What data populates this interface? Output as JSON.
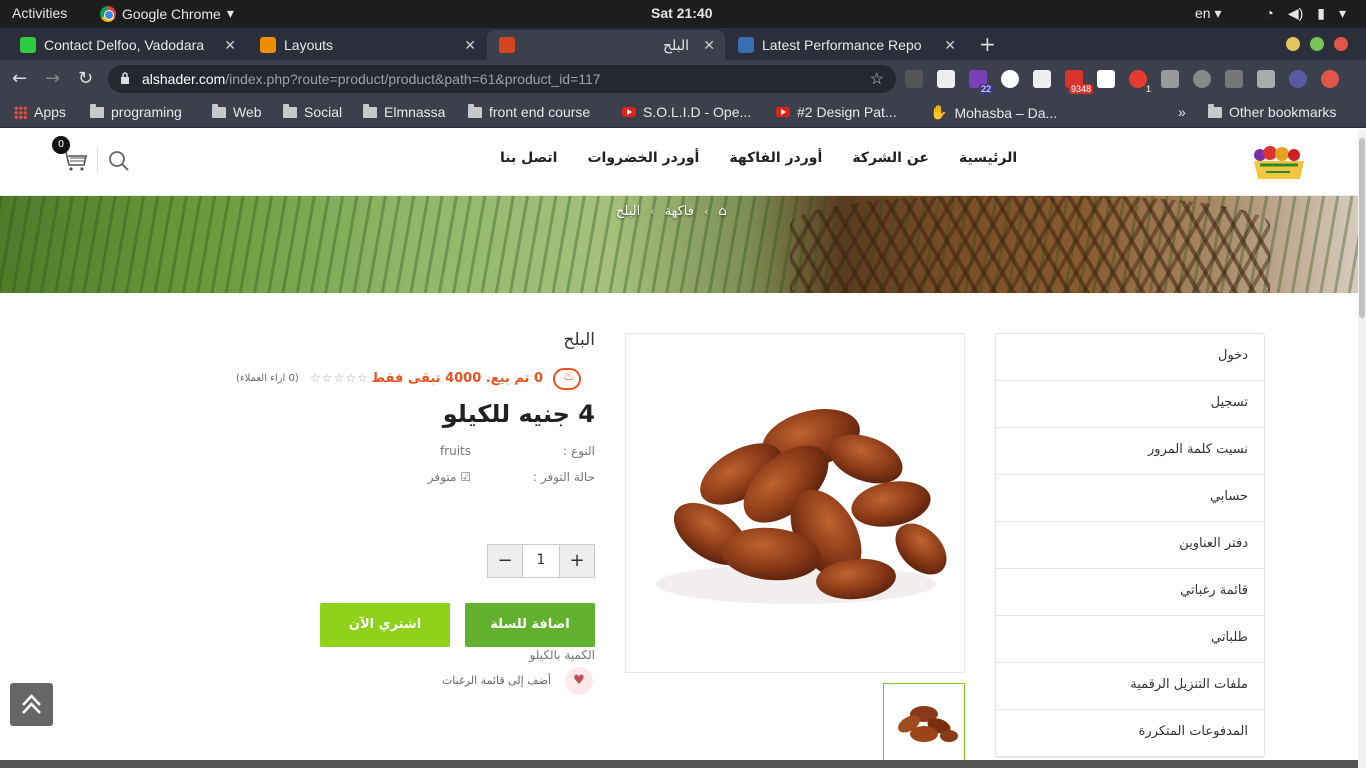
{
  "os": {
    "activities": "Activities",
    "app_name": "Google Chrome",
    "clock": "Sat 21:40",
    "lang": "en"
  },
  "tabs": [
    {
      "label": "Contact Delfoo, Vadodara"
    },
    {
      "label": "Layouts"
    },
    {
      "label": "البلح"
    },
    {
      "label": "Latest Performance Repo"
    }
  ],
  "address": {
    "host": "alshader.com",
    "path": "/index.php?route=product/product&path=61&product_id=117"
  },
  "extensions": {
    "badge_1": "22",
    "badge_2": "9348",
    "badge_3": "1"
  },
  "bookmarks": {
    "apps": "Apps",
    "items": [
      "programing",
      "Web",
      "Social",
      "Elmnassa",
      "front end course"
    ],
    "videos": [
      "S.O.L.I.D - Ope...",
      "#2 Design Pat..."
    ],
    "mohasba": "Mohasba – Da...",
    "more": "»",
    "other": "Other bookmarks"
  },
  "site": {
    "cart_count": "0",
    "menu": [
      "الرئيسية",
      "عن الشركة",
      "أوردر الفاكهة",
      "أوردر الخضروات",
      "اتصل بنا"
    ],
    "breadcrumb": [
      "فاكهة",
      "البلح"
    ]
  },
  "account_links": [
    "دخول",
    "تسجيل",
    "نسيت كلمة المرور",
    "حسابي",
    "دفتر العناوين",
    "قائمة رغباتي",
    "طلباتي",
    "ملفات التنزيل الرقمية",
    "المدفوعات المتكررة"
  ],
  "product": {
    "title": "البلح",
    "sold": "0 تم بيع. 4000 تبقى فقط",
    "reviews": "(0 اراء العملاء)",
    "rating": 0,
    "price": "4 جنيه للكيلو",
    "type_label": "النوع :",
    "type_value": "fruits",
    "stock_label": "حالة التوفر :",
    "stock_value": "متوفر",
    "qty_label": "الكمية بالكيلو",
    "qty": "1",
    "add_to_cart": "اضافة للسلة",
    "buy_now": "اشتري الآن",
    "wishlist": "أضف إلى قائمة الرغبات"
  },
  "colors": {
    "accent_green": "#62b12e",
    "buy_green": "#8ed21a",
    "sale_orange": "#e8531f"
  }
}
